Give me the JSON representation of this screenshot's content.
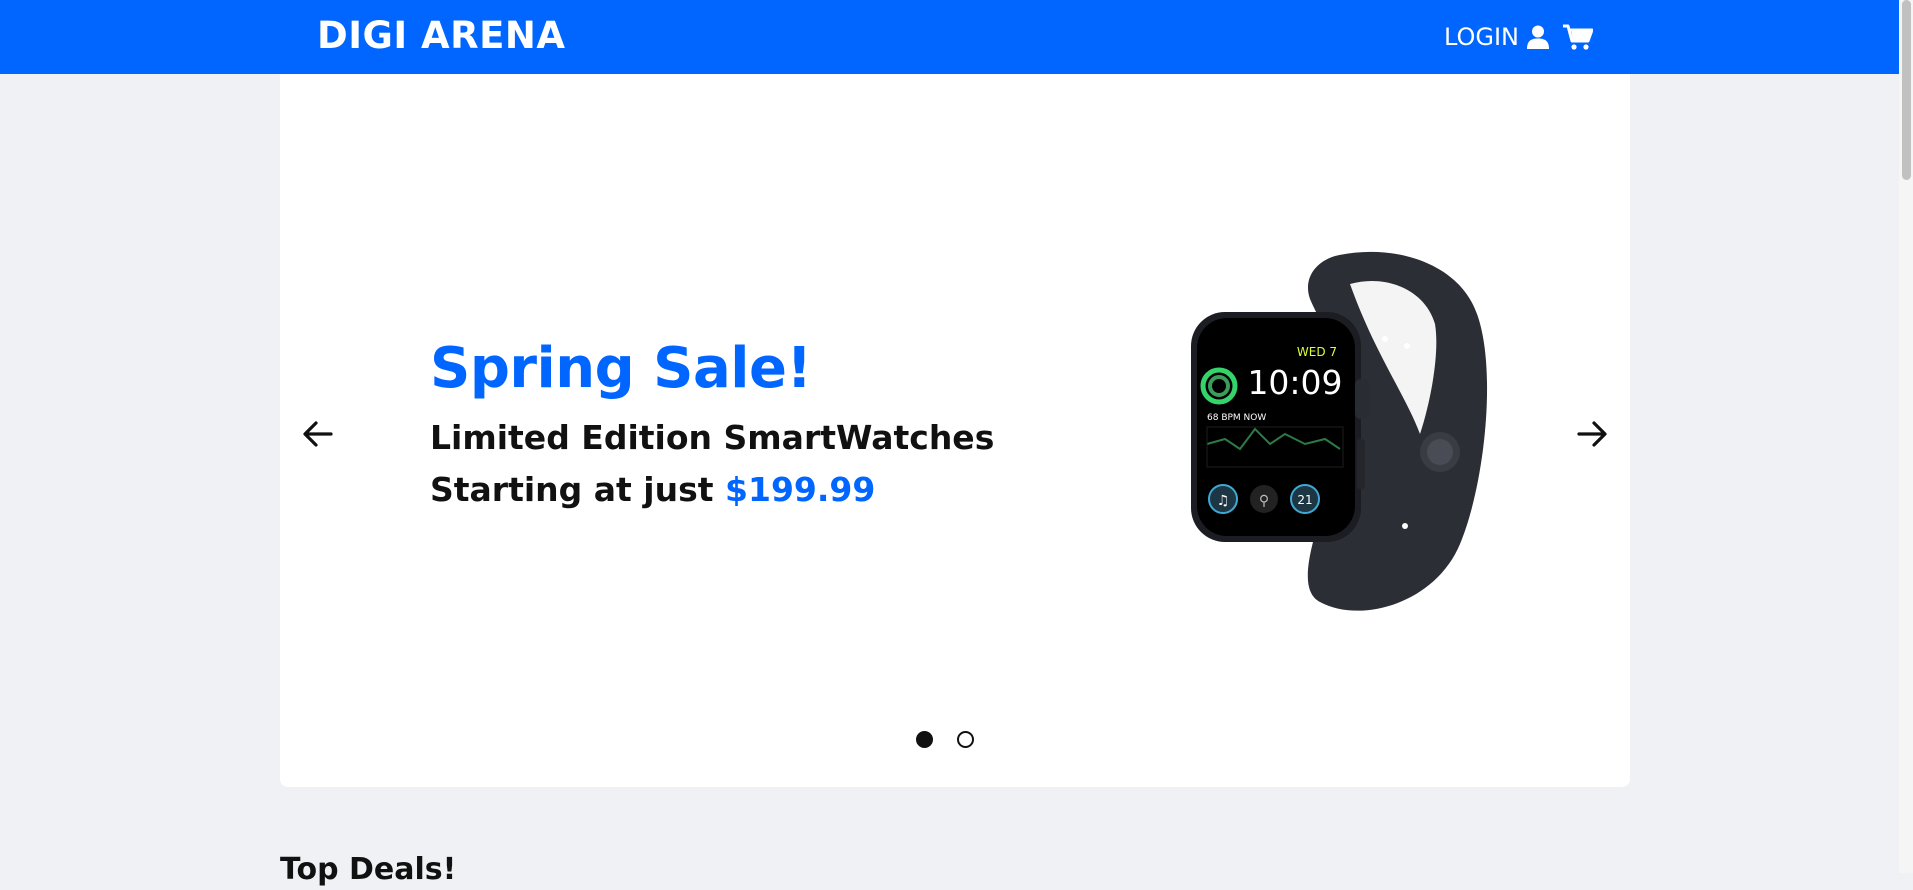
{
  "navbar": {
    "brand": "DIGI ARENA",
    "login_label": "LOGIN",
    "user_icon": "user-icon",
    "cart_icon": "shopping-cart-icon",
    "accent_color": "#0066ff"
  },
  "carousel": {
    "slides": [
      {
        "headline": "Spring Sale!",
        "subtext": "Limited Edition SmartWatches Starting at just",
        "price": "$199.99",
        "image": "smartwatch",
        "watch_face": {
          "day": "WED 7",
          "time": "10:09",
          "bpm": "68 BPM NOW",
          "complication": "21"
        }
      }
    ],
    "active_slide": 1,
    "slide_count": 2,
    "prev_icon": "arrow-left-icon",
    "next_icon": "arrow-right-icon"
  },
  "sections": {
    "top_deals_title": "Top Deals!"
  }
}
